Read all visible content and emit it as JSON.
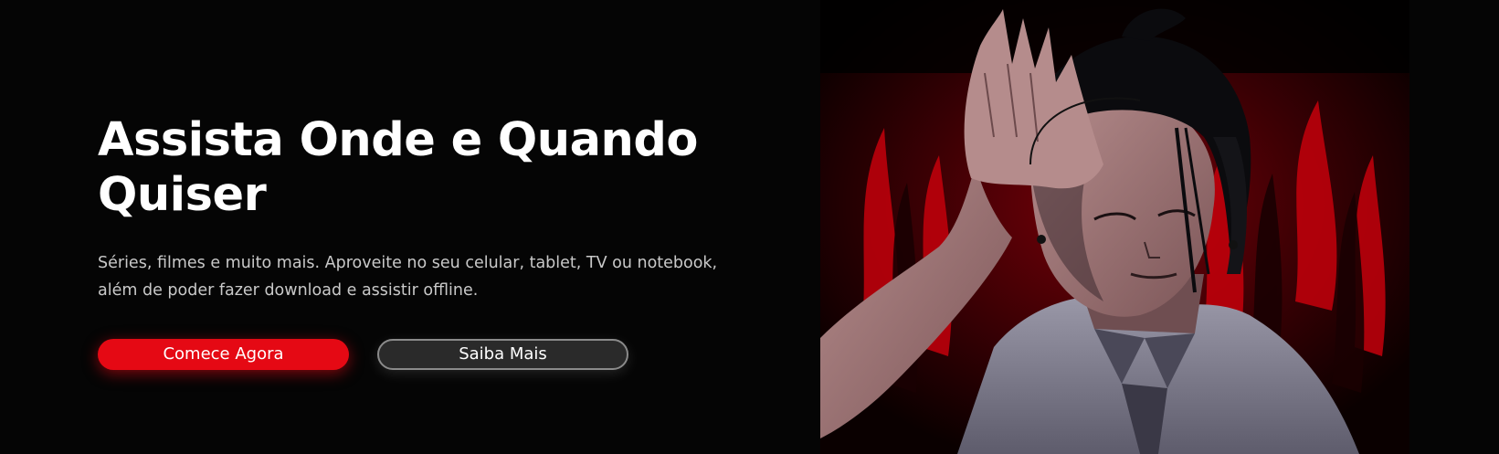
{
  "hero": {
    "title_line1": "Assista Onde e Quando",
    "title_line2": "Quiser",
    "subtitle_line1": "Séries, filmes e muito mais. Aproveite no seu celular, tablet, TV ou notebook,",
    "subtitle_line2": "além de poder fazer download e assistir offline.",
    "primary_button_label": "Comece Agora",
    "secondary_button_label": "Saiba Mais",
    "illustration_icon": "anime-character-illustration"
  },
  "colors": {
    "background": "#050505",
    "accent": "#e50914",
    "secondary_button_bg": "#2a2a2a",
    "subtitle_text": "#c9c9c9",
    "illustration_red": "#c4000c"
  }
}
